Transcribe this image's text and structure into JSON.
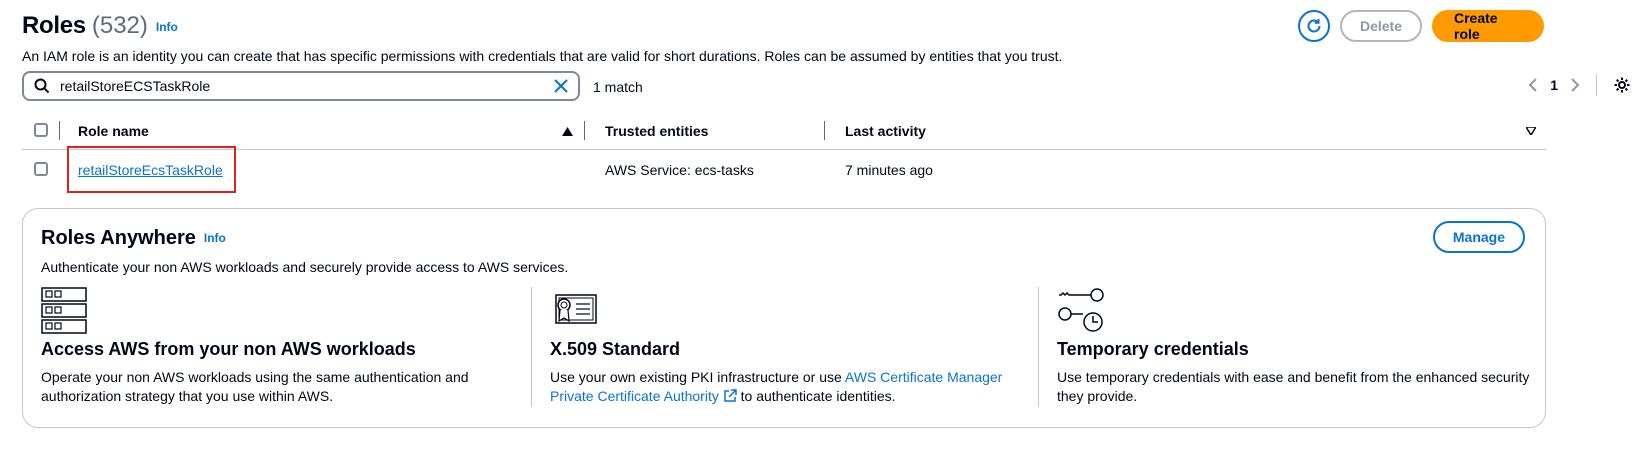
{
  "header": {
    "title": "Roles",
    "count": "(532)",
    "info": "Info",
    "description": "An IAM role is an identity you can create that has specific permissions with credentials that are valid for short durations. Roles can be assumed by entities that you trust.",
    "delete_label": "Delete",
    "create_label": "Create role"
  },
  "search": {
    "value": "retailStoreECSTaskRole",
    "match_text": "1 match"
  },
  "pagination": {
    "page": "1"
  },
  "table": {
    "columns": [
      "Role name",
      "Trusted entities",
      "Last activity"
    ],
    "rows": [
      {
        "role_name": "retailStoreEcsTaskRole",
        "trusted": "AWS Service: ecs-tasks",
        "last_activity": "7 minutes ago"
      }
    ]
  },
  "roles_anywhere": {
    "title": "Roles Anywhere",
    "info": "Info",
    "description": "Authenticate your non AWS workloads and securely provide access to AWS services.",
    "manage_label": "Manage",
    "features": [
      {
        "title": "Access AWS from your non AWS workloads",
        "text": "Operate your non AWS workloads using the same authentication and authorization strategy that you use within AWS.",
        "icon": "server-rack-icon"
      },
      {
        "title": "X.509 Standard",
        "text_before": "Use your own existing PKI infrastructure or use ",
        "link": "AWS Certificate Manager Private Certificate Authority",
        "text_after": " to authenticate identities.",
        "icon": "certificate-icon"
      },
      {
        "title": "Temporary credentials",
        "text": "Use temporary credentials with ease and benefit from the enhanced security they provide.",
        "icon": "keys-clock-icon"
      }
    ]
  },
  "colors": {
    "link": "#0972d3",
    "primary": "#ff9900",
    "highlight": "#e02020"
  }
}
